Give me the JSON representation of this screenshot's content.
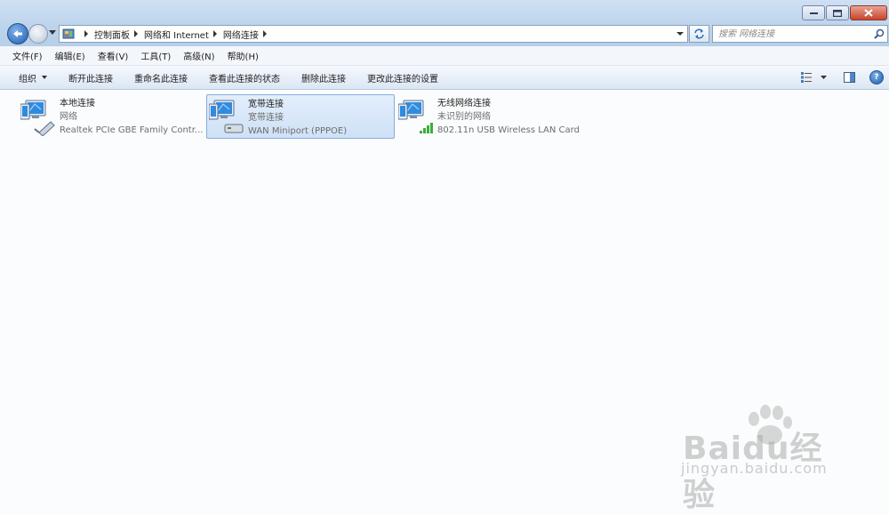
{
  "window": {
    "buttons": {
      "minimize": "minimize-icon",
      "maximize": "maximize-icon",
      "close": "close-icon"
    }
  },
  "address": {
    "crumbs": [
      "控制面板",
      "网络和 Internet",
      "网络连接"
    ]
  },
  "search": {
    "placeholder": "搜索 网络连接"
  },
  "menubar": {
    "items": [
      "文件(F)",
      "编辑(E)",
      "查看(V)",
      "工具(T)",
      "高级(N)",
      "帮助(H)"
    ]
  },
  "commandbar": {
    "organize": "组织",
    "disconnect": "断开此连接",
    "rename": "重命名此连接",
    "view_status": "查看此连接的状态",
    "delete": "删除此连接",
    "change_settings": "更改此连接的设置",
    "help": "?"
  },
  "connections": [
    {
      "name": "本地连接",
      "status": "网络",
      "device": "Realtek PCIe GBE Family Contr...",
      "icon": "ethernet-connection-icon"
    },
    {
      "name": "宽带连接",
      "status": "宽带连接",
      "device": "WAN Miniport (PPPOE)",
      "icon": "broadband-connection-icon",
      "selected": true
    },
    {
      "name": "无线网络连接",
      "status": "未识别的网络",
      "device": "802.11n USB Wireless LAN Card",
      "icon": "wireless-connection-icon"
    }
  ],
  "watermark": {
    "logo_text": "Baidu经验",
    "url": "jingyan.baidu.com"
  }
}
